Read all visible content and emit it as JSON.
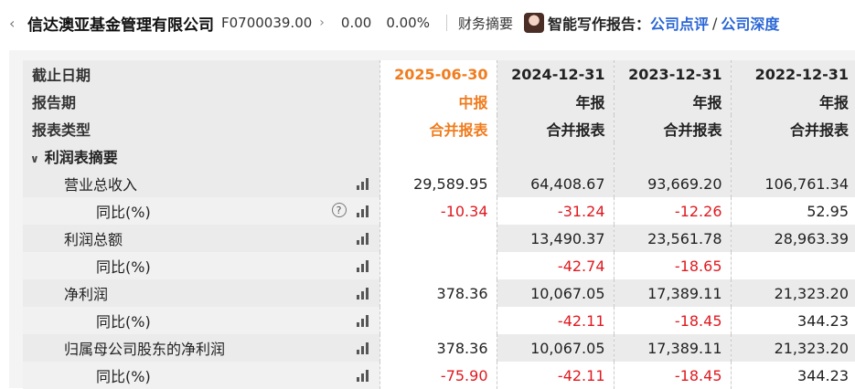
{
  "topbar": {
    "back_icon": "chevron-left-icon",
    "company_name": "信达澳亚基金管理有限公司",
    "code": "F0700039.00",
    "chevron_icon": "chevron-right-icon",
    "price": "0.00",
    "change_pct": "0.00%",
    "menu_label": "财务摘要",
    "ai_label": "智能写作报告：",
    "link_1": "公司点评",
    "slash": "/",
    "link_2": "公司深度"
  },
  "table": {
    "header": {
      "date_label": "截止日期",
      "period_label": "报告期",
      "type_label": "报表类型",
      "dates": [
        "2025-06-30",
        "2024-12-31",
        "2023-12-31",
        "2022-12-31"
      ],
      "periods": [
        "中报",
        "年报",
        "年报",
        "年报"
      ],
      "types": [
        "合并报表",
        "合并报表",
        "合并报表",
        "合并报表"
      ]
    },
    "section_label": "利润表摘要",
    "rows": [
      {
        "label": "营业总收入",
        "values": [
          "29,589.95",
          "64,408.67",
          "93,669.20",
          "106,761.34"
        ]
      },
      {
        "label": "同比(%)",
        "values": [
          "-10.34",
          "-31.24",
          "-12.26",
          "52.95"
        ]
      },
      {
        "label": "利润总额",
        "values": [
          "",
          "13,490.37",
          "23,561.78",
          "28,963.39"
        ]
      },
      {
        "label": "同比(%)",
        "values": [
          "",
          "-42.74",
          "-18.65",
          ""
        ]
      },
      {
        "label": "净利润",
        "values": [
          "378.36",
          "10,067.05",
          "17,389.11",
          "21,323.20"
        ]
      },
      {
        "label": "同比(%)",
        "values": [
          "",
          "-42.11",
          "-18.45",
          "344.23"
        ]
      },
      {
        "label": "归属母公司股东的净利润",
        "values": [
          "378.36",
          "10,067.05",
          "17,389.11",
          "21,323.20"
        ]
      },
      {
        "label": "同比(%)",
        "values": [
          "-75.90",
          "-42.11",
          "-18.45",
          "344.23"
        ]
      }
    ]
  },
  "colors": {
    "accent_orange": "#f07c1e",
    "negative_red": "#e0191f",
    "link_blue": "#2a66d6"
  }
}
